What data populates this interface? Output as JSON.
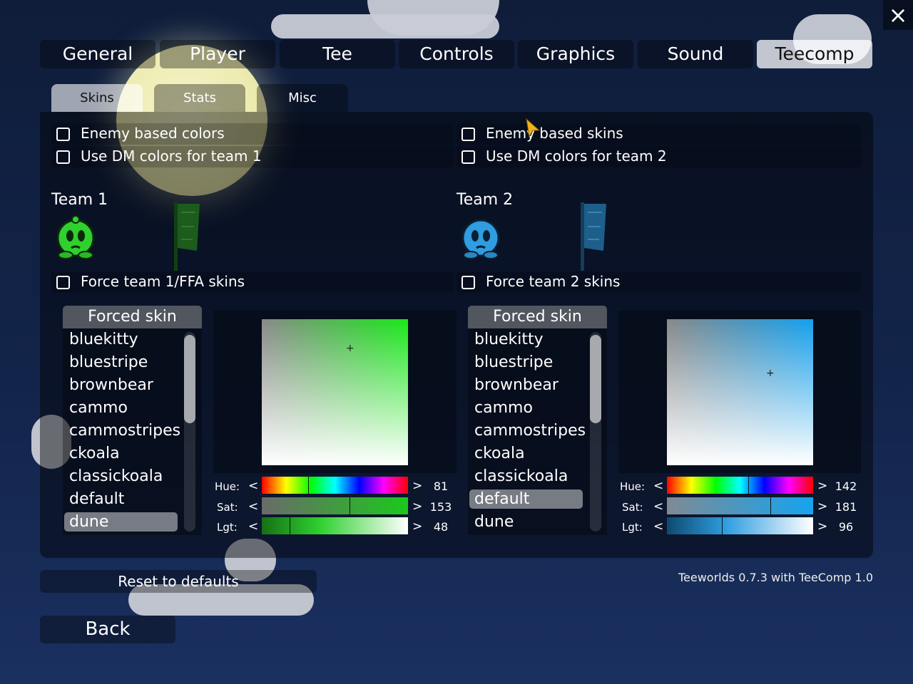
{
  "tabs": [
    "General",
    "Player",
    "Tee",
    "Controls",
    "Graphics",
    "Sound",
    "Teecomp"
  ],
  "active_tab": "Teecomp",
  "subtabs": [
    "Skins",
    "Stats",
    "Misc"
  ],
  "checkboxes": {
    "enemy_colors": "Enemy based colors",
    "dm_team1": "Use DM colors for team 1",
    "enemy_skins": "Enemy based skins",
    "dm_team2": "Use DM colors for team 2",
    "force_team1": "Force team 1/FFA skins",
    "force_team2": "Force team 2 skins"
  },
  "team1": {
    "label": "Team 1",
    "color": "#2fd12f",
    "flag_color": "#1c5c1c"
  },
  "team2": {
    "label": "Team 2",
    "color": "#2f9de0",
    "flag_color": "#1d5f8a"
  },
  "skin_list_header": "Forced skin",
  "skins": [
    "bluekitty",
    "bluestripe",
    "brownbear",
    "cammo",
    "cammostripes",
    "ckoala",
    "classickoala",
    "default",
    "dune"
  ],
  "team1_selected_skin": "dune",
  "team2_selected_skin": "default",
  "sliders": {
    "hue_label": "Hue:",
    "sat_label": "Sat:",
    "lgt_label": "Lgt:",
    "dec": "<",
    "inc": ">",
    "team1": {
      "hue": "81",
      "sat": "153",
      "lgt": "48"
    },
    "team2": {
      "hue": "142",
      "sat": "181",
      "lgt": "96"
    }
  },
  "reset_button": "Reset to defaults",
  "back_button": "Back",
  "version": "Teeworlds 0.7.3 with TeeComp 1.0",
  "close_icon": "×"
}
